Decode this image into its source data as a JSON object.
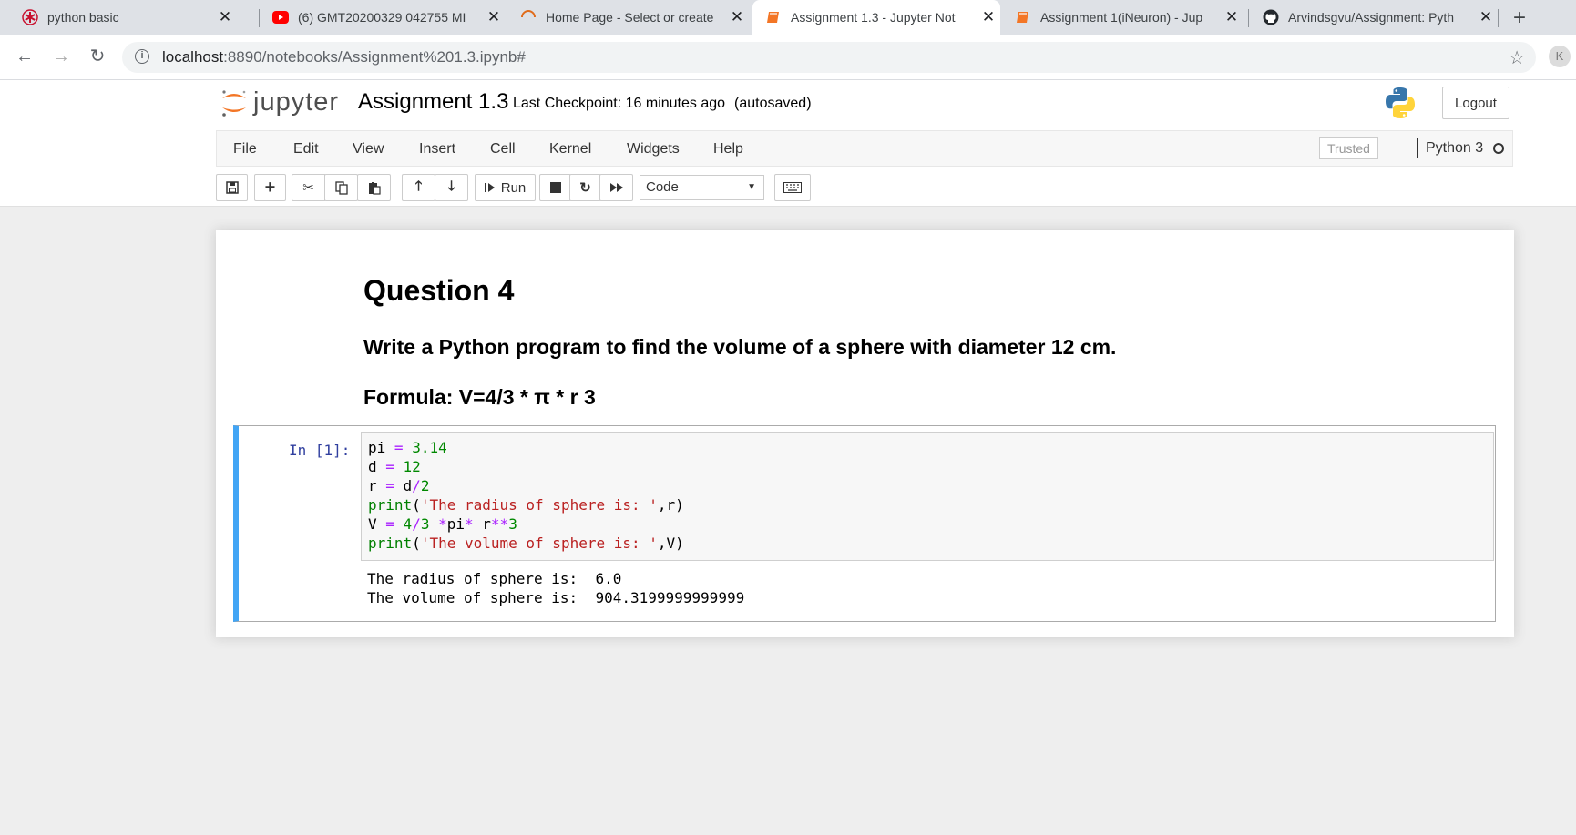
{
  "browser": {
    "tabs": [
      {
        "title": "python basic",
        "icon": "asterisk-red-icon",
        "active": false
      },
      {
        "title": "(6) GMT20200329 042755 MI",
        "icon": "youtube-icon",
        "active": false
      },
      {
        "title": "Home Page - Select or create",
        "icon": "loading-spinner-icon",
        "active": false
      },
      {
        "title": "Assignment 1.3 - Jupyter Not",
        "icon": "jupyter-book-icon",
        "active": true
      },
      {
        "title": "Assignment 1(iNeuron) - Jup",
        "icon": "jupyter-book-icon",
        "active": false
      },
      {
        "title": "Arvindsgvu/Assignment: Pyth",
        "icon": "github-icon",
        "active": false
      }
    ],
    "url_host": "localhost",
    "url_path": ":8890/notebooks/Assignment%201.3.ipynb#",
    "profile_initial": "K"
  },
  "jupyter": {
    "logo_text": "jupyter",
    "notebook_name": "Assignment 1.3",
    "checkpoint": "Last Checkpoint: 16 minutes ago",
    "autosave": "(autosaved)",
    "logout_label": "Logout",
    "menu": [
      "File",
      "Edit",
      "View",
      "Insert",
      "Cell",
      "Kernel",
      "Widgets",
      "Help"
    ],
    "trusted_label": "Trusted",
    "kernel_name": "Python 3",
    "run_label": "Run",
    "cell_type": "Code"
  },
  "notebook": {
    "heading": "Question 4",
    "question": "Write a Python program to find the volume of a sphere with diameter 12 cm.",
    "formula": "Formula: V=4/3 * π * r 3",
    "cell": {
      "prompt": "In [1]:",
      "code_lines": [
        "pi = 3.14",
        "d = 12",
        "r = d/2",
        "print('The radius of sphere is: ',r)",
        "V = 4/3 *pi* r**3",
        "print('The volume of sphere is: ',V)"
      ],
      "output_lines": [
        "The radius of sphere is:  6.0",
        "The volume of sphere is:  904.3199999999999"
      ]
    }
  },
  "colors": {
    "cell_selected_border": "#42a5f5",
    "prompt_color": "#303f9f",
    "keyword_op": "#aa22ff",
    "number": "#008800",
    "string": "#ba2121"
  }
}
